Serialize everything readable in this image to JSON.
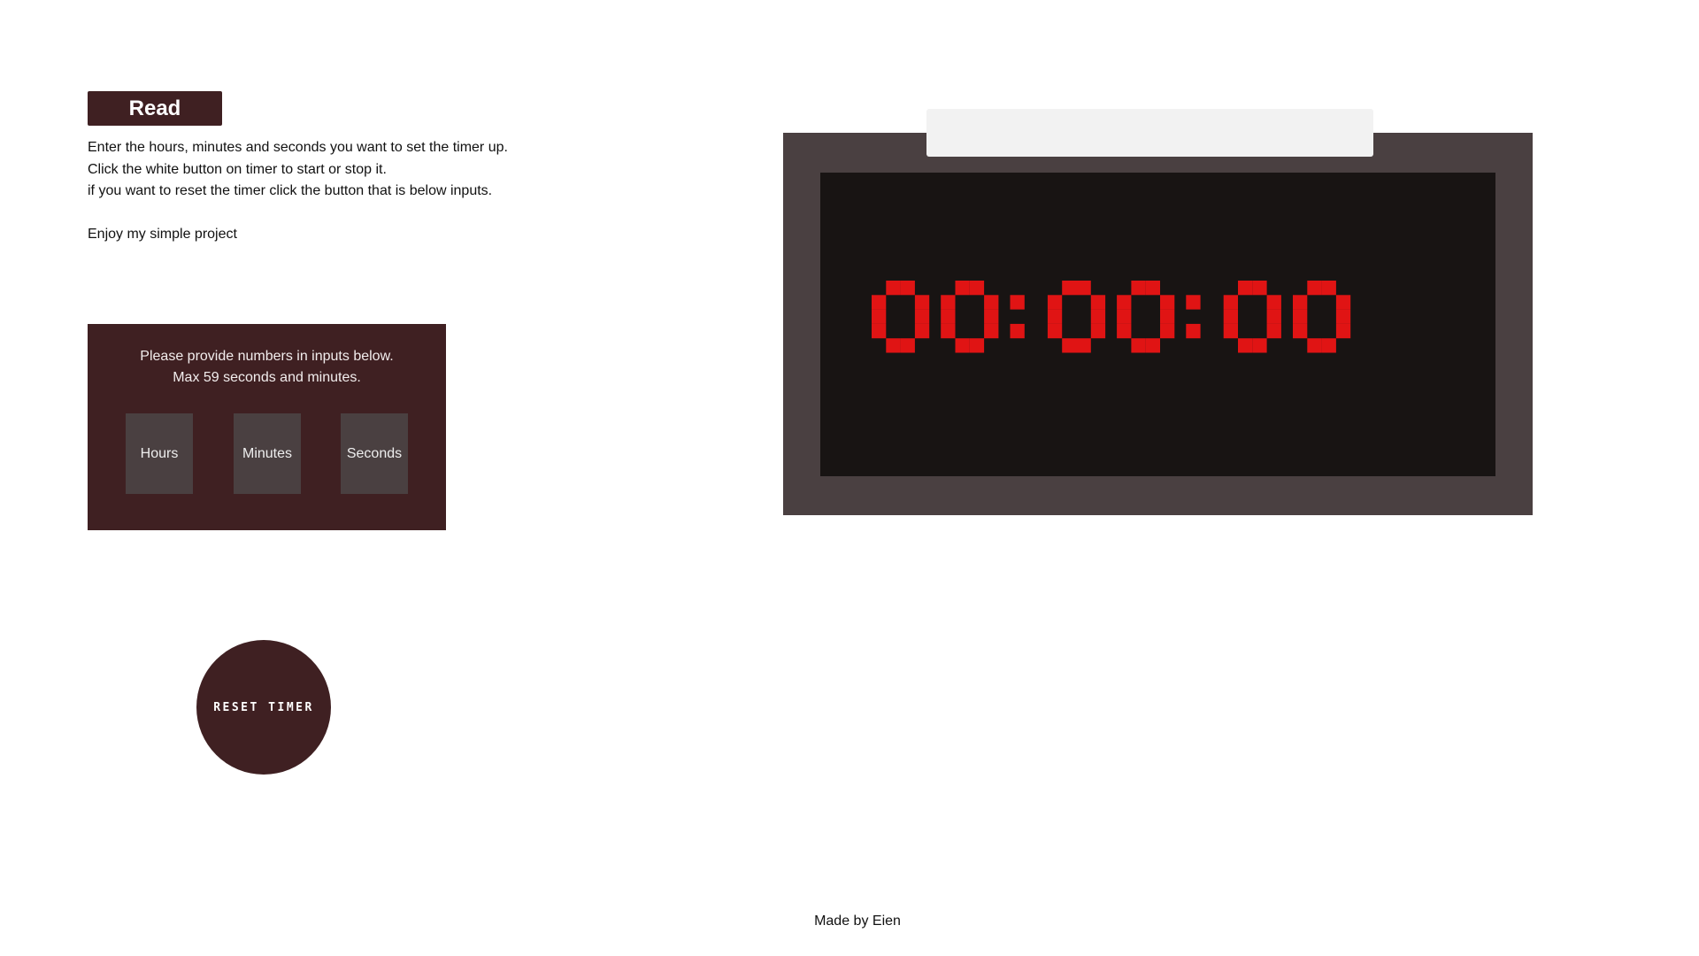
{
  "read": {
    "title": "Read",
    "lines": [
      "Enter the hours, minutes and seconds you want to set the timer up.",
      "Click the white button on timer to start or stop it.",
      "if you want to reset the timer click the button that is below inputs."
    ],
    "closing": "Enjoy my simple project"
  },
  "inputs": {
    "note_line1": "Please provide numbers in inputs below.",
    "note_line2": "Max 59 seconds and minutes.",
    "hours_placeholder": "Hours",
    "minutes_placeholder": "Minutes",
    "seconds_placeholder": "Seconds"
  },
  "reset": {
    "label": "RESET TIMER"
  },
  "timer": {
    "display": "00:00:00"
  },
  "footer": {
    "text": "Made by Eien"
  },
  "colors": {
    "brand": "#3f2022",
    "timer_frame": "#4a4041",
    "timer_screen": "#181413",
    "digit": "#e01414",
    "start_button": "#f2f2f2"
  }
}
